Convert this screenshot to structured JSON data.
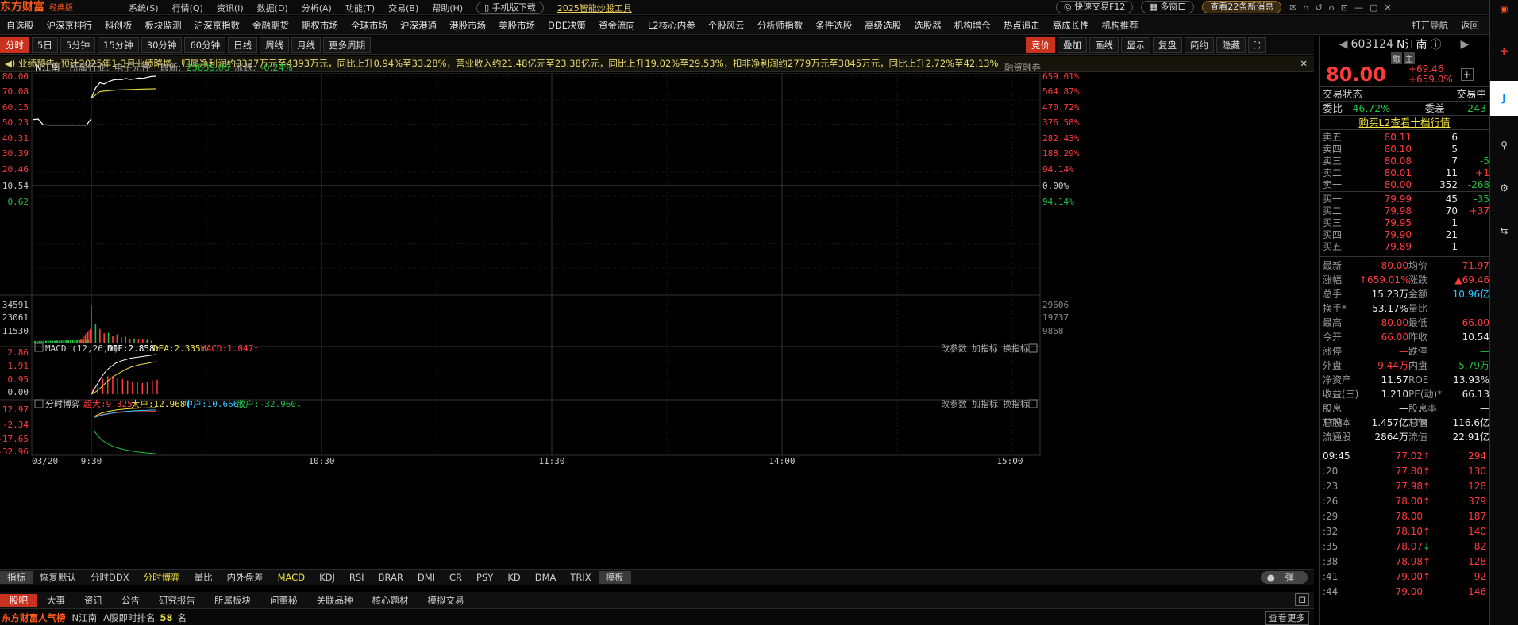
{
  "app": {
    "logo": "东方财富",
    "edition": "经典版"
  },
  "menu": [
    "系统(S)",
    "行情(Q)",
    "资讯(I)",
    "数据(D)",
    "分析(A)",
    "功能(T)",
    "交易(B)",
    "帮助(H)"
  ],
  "mobile_download": "手机版下载",
  "promo": "2025智能炒股工具",
  "quick_trade": "快速交易F12",
  "multi_window": "多窗口",
  "news_badge": "查看22条新消息",
  "nav": [
    "自选股",
    "沪深京排行",
    "科创板",
    "板块监测",
    "沪深京指数",
    "金融期货",
    "期权市场",
    "全球市场",
    "沪深港通",
    "港股市场",
    "美股市场",
    "DDE决策",
    "资金流向",
    "L2核心内参",
    "个股风云",
    "分析师指数",
    "条件选股",
    "高级选股",
    "选股器",
    "机构增仓",
    "热点追击",
    "高成长性",
    "机构推荐",
    "打开导航",
    "返回"
  ],
  "timeframes": [
    "分时",
    "5日",
    "5分钟",
    "15分钟",
    "30分钟",
    "60分钟",
    "日线",
    "周线",
    "月线",
    "更多周期"
  ],
  "chart_tools": [
    "竞价",
    "叠加",
    "画线",
    "显示",
    "复盘",
    "简约",
    "隐藏"
  ],
  "notice": "业绩预告: 预计2025年1-3月业绩略增，归属净利润约3327万元至4393万元，同比上升0.94%至33.28%，营业收入约21.48亿元至23.38亿元，同比上升19.02%至29.53%，扣非净利润约2779万元至3845万元，同比上升2.72%至42.13%",
  "chart_header": {
    "name": "N江南",
    "industry_label": "所属行业:",
    "industry": "电子元件",
    "latest_label": "最新:",
    "latest": "25839.06",
    "change_label": "涨跌:",
    "change": "-0.24%",
    "margin": "融资融券"
  },
  "chart_data": {
    "type": "line",
    "price_axis_left": [
      "80.00",
      "70.08",
      "60.15",
      "50.23",
      "40.31",
      "30.39",
      "20.46",
      "10.54",
      "0.62"
    ],
    "price_axis_right": [
      "659.01%",
      "564.87%",
      "470.72%",
      "376.58%",
      "282.43%",
      "188.29%",
      "94.14%",
      "0.00%",
      "94.14%"
    ],
    "x_ticks": [
      "03/20",
      "9:30",
      "10:30",
      "11:30",
      "14:00",
      "15:00"
    ],
    "auction_price": {
      "x": [
        0,
        0.5,
        1,
        1.5,
        2,
        2.5,
        3,
        3.5,
        4,
        4.5,
        5,
        5.5,
        6
      ],
      "y": [
        52.5,
        52.8,
        49.2,
        49.0,
        49.0,
        49.0,
        49.0,
        49.0,
        49.0,
        49.0,
        49.0,
        49.0,
        53.0
      ]
    },
    "price": {
      "x": [
        0,
        1,
        2,
        3,
        4,
        5,
        6,
        7,
        8,
        9,
        10,
        11,
        12,
        13,
        14,
        15
      ],
      "y": [
        66.0,
        72.5,
        75.8,
        75.0,
        76.5,
        77.5,
        78.0,
        77.8,
        78.5,
        78.0,
        78.2,
        78.8,
        78.6,
        79.2,
        79.8,
        80.0
      ]
    },
    "avg_price": {
      "x": [
        0,
        2,
        4,
        6,
        8,
        10,
        12,
        15
      ],
      "y": [
        66.0,
        70.2,
        70.8,
        71.2,
        71.4,
        71.6,
        71.8,
        71.97
      ]
    },
    "volume_axis_left": [
      "34591",
      "23061",
      "11530"
    ],
    "volume_axis_right": [
      "29606",
      "19737",
      "9868"
    ],
    "volume": {
      "x": [
        0,
        1,
        2,
        3,
        4,
        5,
        6,
        7,
        8,
        9,
        10,
        11,
        12,
        13,
        14
      ],
      "y": [
        33500,
        16500,
        12500,
        8500,
        9000,
        6500,
        7500,
        5000,
        5500,
        3200,
        3800,
        2800,
        3000,
        2500,
        1800
      ]
    },
    "macd": {
      "label": "MACD (12,26,9)",
      "dif_label": "DIF:2.858↑",
      "dea_label": "DEA:2.335↑",
      "macd_label": "MACD:1.047↑",
      "axis": [
        "2.86",
        "1.91",
        "0.95",
        "0.00"
      ],
      "dif": [
        0.0,
        0.6,
        1.2,
        1.7,
        2.0,
        2.25,
        2.4,
        2.5,
        2.6,
        2.65,
        2.7,
        2.75,
        2.8,
        2.86
      ],
      "dea": [
        0.0,
        0.2,
        0.5,
        0.85,
        1.15,
        1.4,
        1.6,
        1.8,
        1.95,
        2.05,
        2.15,
        2.2,
        2.28,
        2.335
      ],
      "hist": [
        0.4,
        0.8,
        1.1,
        1.3,
        1.3,
        1.2,
        1.1,
        1.0,
        0.9,
        0.9,
        0.8,
        0.9,
        1.0,
        1.047
      ]
    },
    "flow": {
      "label": "分时博弈",
      "super": "超大:9.325↑",
      "big": "大户:12.968↑",
      "mid": "中户:10.666↑",
      "retail": "散户:-32.960↓",
      "axis": [
        "12.97",
        "-2.34",
        "-17.65",
        "-32.96"
      ],
      "super_s": [
        3.5,
        6.0,
        7.2,
        8.0,
        8.5,
        8.8,
        9.0,
        9.2,
        9.325
      ],
      "big_s": [
        4.0,
        7.5,
        9.5,
        10.8,
        11.6,
        12.2,
        12.6,
        12.8,
        12.968
      ],
      "mid_s": [
        3.0,
        5.5,
        7.0,
        8.3,
        9.1,
        9.8,
        10.2,
        10.4,
        10.666
      ],
      "retail_s": [
        -10.0,
        -19.0,
        -24.0,
        -27.0,
        -29.0,
        -30.5,
        -31.6,
        -32.4,
        -32.96
      ]
    },
    "panel_actions": [
      "改参数",
      "加指标",
      "换指标"
    ]
  },
  "indicator_tabs": [
    "指标",
    "恢复默认",
    "分时DDX",
    "分时博弈",
    "量比",
    "内外盘差",
    "MACD",
    "KDJ",
    "RSI",
    "BRAR",
    "DMI",
    "CR",
    "PSY",
    "KD",
    "DMA",
    "TRIX",
    "模板"
  ],
  "popup": "弹",
  "bottom_tabs": [
    "股吧",
    "大事",
    "资讯",
    "公告",
    "研究报告",
    "所属板块",
    "问董秘",
    "关联品种",
    "核心题材",
    "模拟交易"
  ],
  "popularity": {
    "title": "东方财富人气榜",
    "stock": "N江南",
    "rank_label": "A股即时排名",
    "rank": "58",
    "unit": "名",
    "more": "查看更多"
  },
  "quote": {
    "code": "603124",
    "name": "N江南",
    "tags": [
      "融",
      "主"
    ],
    "price": "80.00",
    "change": "+69.46",
    "pct": "+659.0%",
    "status_label": "交易状态",
    "status": "交易中",
    "wb_label": "委比",
    "wb": "-46.72%",
    "wc_label": "委差",
    "wc": "-243",
    "l2": "购买L2查看十档行情",
    "asks": [
      {
        "l": "卖五",
        "p": "80.11",
        "v": "6",
        "d": ""
      },
      {
        "l": "卖四",
        "p": "80.10",
        "v": "5",
        "d": ""
      },
      {
        "l": "卖三",
        "p": "80.08",
        "v": "7",
        "d": "-5"
      },
      {
        "l": "卖二",
        "p": "80.01",
        "v": "11",
        "d": "+1"
      },
      {
        "l": "卖一",
        "p": "80.00",
        "v": "352",
        "d": "-268"
      }
    ],
    "bids": [
      {
        "l": "买一",
        "p": "79.99",
        "v": "45",
        "d": "-35"
      },
      {
        "l": "买二",
        "p": "79.98",
        "v": "70",
        "d": "+37"
      },
      {
        "l": "买三",
        "p": "79.95",
        "v": "1",
        "d": ""
      },
      {
        "l": "买四",
        "p": "79.90",
        "v": "21",
        "d": ""
      },
      {
        "l": "买五",
        "p": "79.89",
        "v": "1",
        "d": ""
      }
    ],
    "stats": [
      [
        "最新",
        "80.00",
        "均价",
        "71.97"
      ],
      [
        "涨幅",
        "↑659.01%",
        "涨跌",
        "▲69.46"
      ],
      [
        "总手",
        "15.23万",
        "金额",
        "10.96亿"
      ],
      [
        "换手*",
        "53.17%",
        "量比",
        "—"
      ],
      [
        "最高",
        "80.00",
        "最低",
        "66.00"
      ],
      [
        "今开",
        "66.00",
        "昨收",
        "10.54"
      ],
      [
        "涨停",
        "—",
        "跌停",
        "—"
      ],
      [
        "外盘",
        "9.44万",
        "内盘",
        "5.79万"
      ],
      [
        "净资产",
        "11.57",
        "ROE",
        "13.93%"
      ],
      [
        "收益(三)",
        "1.210",
        "PE(动)*",
        "66.13"
      ],
      [
        "股息TTM",
        "—",
        "股息率TTM",
        "—"
      ],
      [
        "总股本",
        "1.457亿",
        "总值",
        "116.6亿"
      ],
      [
        "流通股",
        "2864万",
        "流值",
        "22.91亿"
      ]
    ],
    "ticks": [
      [
        "09:45",
        "77.02",
        "↑",
        "294"
      ],
      [
        ":20",
        "77.80",
        "↑",
        "130"
      ],
      [
        ":23",
        "77.98",
        "↑",
        "128"
      ],
      [
        ":26",
        "78.00",
        "↑",
        "379"
      ],
      [
        ":29",
        "78.00",
        "",
        "187"
      ],
      [
        ":32",
        "78.10",
        "↑",
        "140"
      ],
      [
        ":35",
        "78.07",
        "↓",
        "82"
      ],
      [
        ":38",
        "78.98",
        "↑",
        "128"
      ],
      [
        ":41",
        "79.00",
        "↑",
        "92"
      ],
      [
        ":44",
        "79.00",
        "",
        "146"
      ]
    ]
  }
}
